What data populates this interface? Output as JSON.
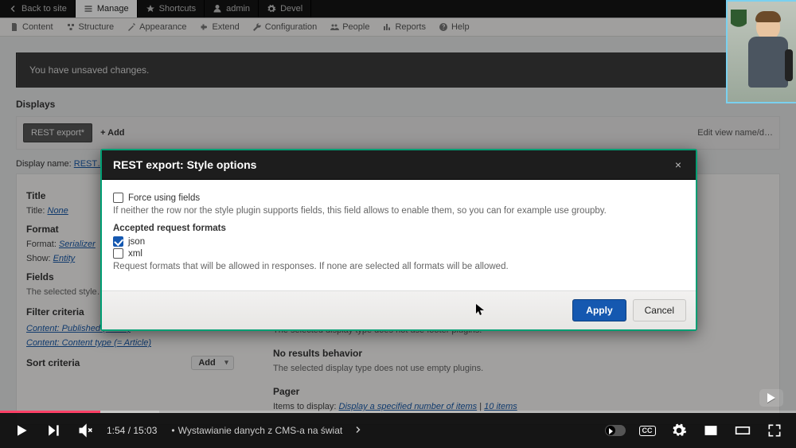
{
  "admin_bar": {
    "back": "Back to site",
    "manage": "Manage",
    "shortcuts": "Shortcuts",
    "admin": "admin",
    "devel": "Devel"
  },
  "sub_bar": {
    "content": "Content",
    "structure": "Structure",
    "appearance": "Appearance",
    "extend": "Extend",
    "configuration": "Configuration",
    "people": "People",
    "reports": "Reports",
    "help": "Help"
  },
  "warn": "You have unsaved changes.",
  "displays_label": "Displays",
  "displays": {
    "rest_export": "REST export*",
    "add": "+ Add",
    "edit_name": "Edit view name/d…"
  },
  "display_name_label": "Display name:",
  "display_name_value": "REST…",
  "left": {
    "title_h": "Title",
    "title_lbl": "Title:",
    "title_val": "None",
    "format_h": "Format",
    "format_lbl": "Format:",
    "format_val": "Serializer",
    "show_lbl": "Show:",
    "show_val": "Entity",
    "fields_h": "Fields",
    "fields_txt": "The selected style…",
    "filter_h": "Filter criteria",
    "add_btn": "Add",
    "filter1": "Content: Published (= Yes)",
    "filter2": "Content: Content type (= Article)",
    "sort_h": "Sort criteria"
  },
  "right": {
    "footer_txt": "The selected display type does not use footer plugins.",
    "noresults_h": "No results behavior",
    "noresults_txt": "The selected display type does not use empty plugins.",
    "pager_h": "Pager",
    "items_lbl": "Items to display:",
    "items_val": "Display a specified number of items",
    "items_count": "10 items"
  },
  "modal": {
    "title": "REST export: Style options",
    "force_lbl": "Force using fields",
    "force_help": "If neither the row nor the style plugin supports fields, this field allows to enable them, so you can for example use groupby.",
    "accepted_h": "Accepted request formats",
    "json": "json",
    "xml": "xml",
    "accepted_help": "Request formats that will be allowed in responses. If none are selected all formats will be allowed.",
    "apply": "Apply",
    "cancel": "Cancel",
    "close": "×"
  },
  "video": {
    "time": "1:54 / 15:03",
    "title": "Wystawianie danych z CMS-a na świat",
    "cc": "CC"
  }
}
